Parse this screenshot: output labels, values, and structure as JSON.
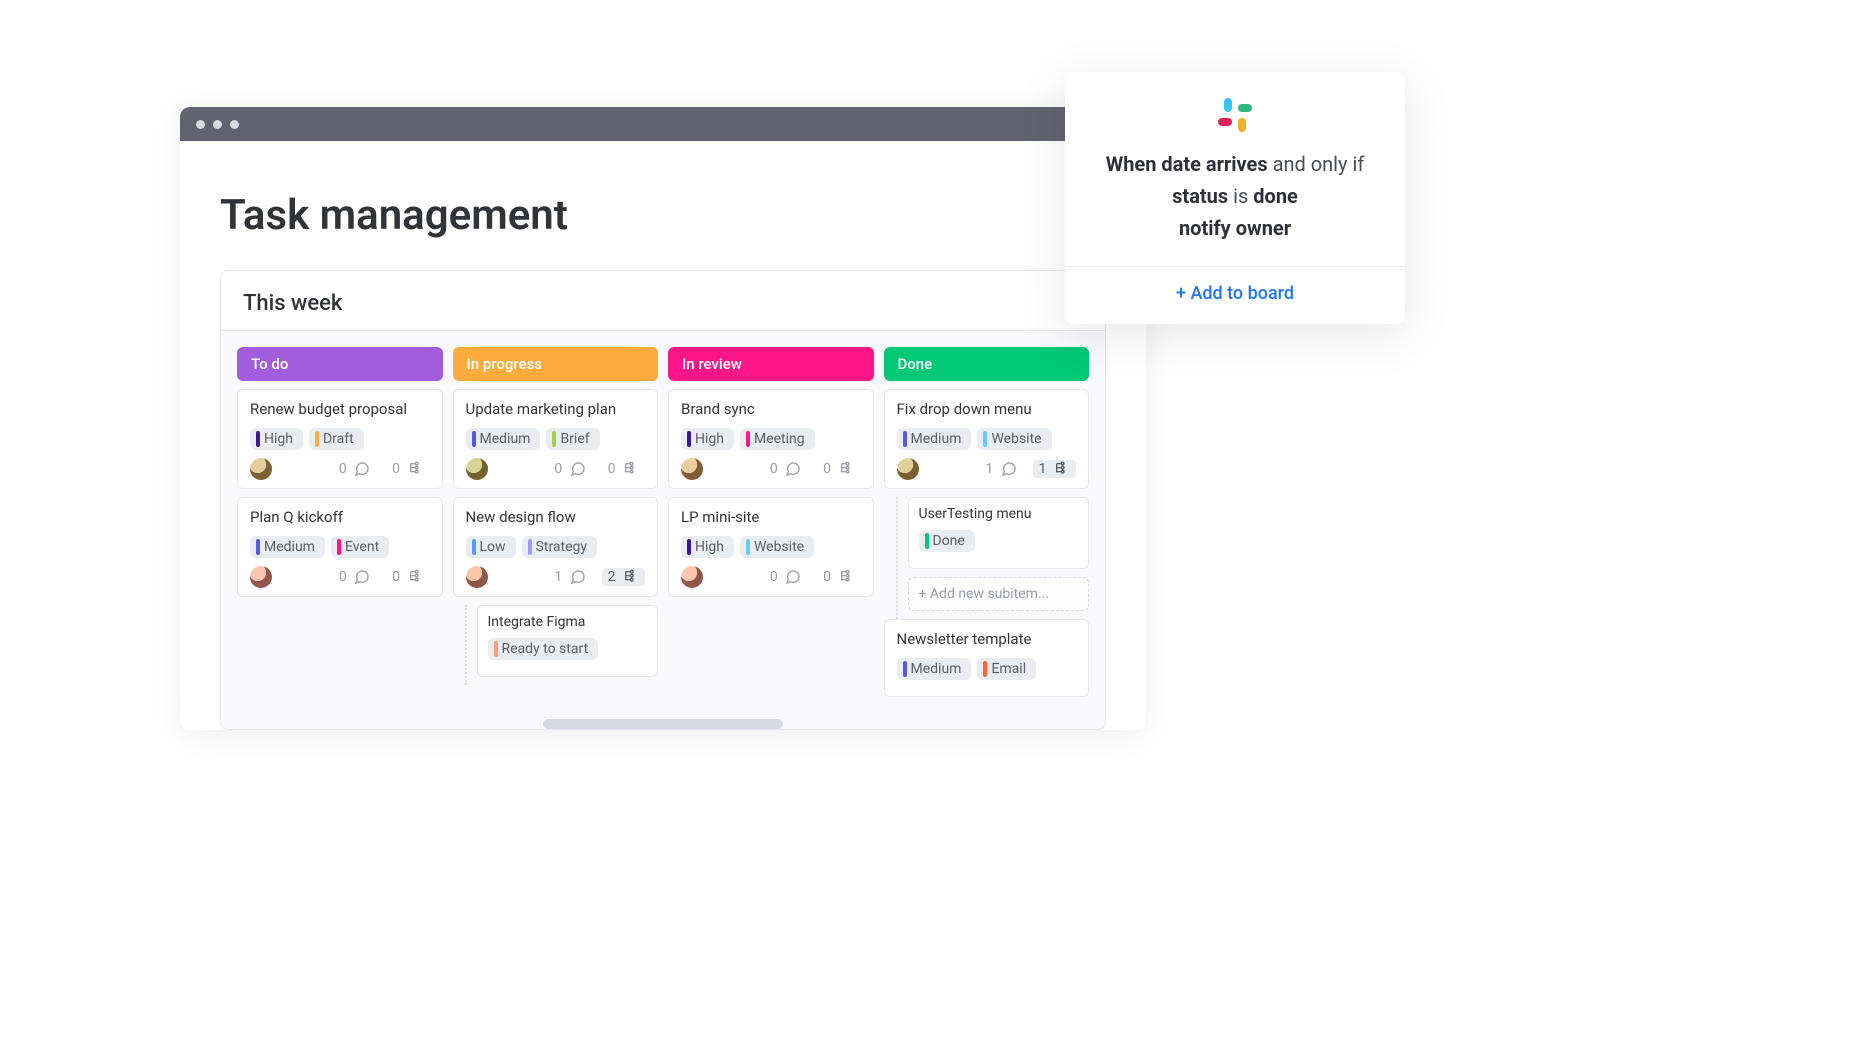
{
  "page": {
    "title": "Task management"
  },
  "group": {
    "title": "This  week"
  },
  "colors": {
    "todo": "#a25ddc",
    "in_progress": "#fdab3d",
    "in_review": "#ff158a",
    "done": "#00c875",
    "high": "#401694",
    "medium": "#5559df",
    "low": "#579bfc",
    "draft": "#fdab3d",
    "brief": "#a4d14b",
    "event": "#ff158a",
    "strategy": "#9d99ff",
    "meeting": "#ff158a",
    "website": "#66ccff",
    "ready": "#ff9d76",
    "done_tag": "#00c875",
    "email": "#ff642e"
  },
  "columns": [
    {
      "id": "todo",
      "title": "To do",
      "color_key": "todo",
      "cards": [
        {
          "title": "Renew budget proposal",
          "tags": [
            {
              "label": "High",
              "color_key": "high"
            },
            {
              "label": "Draft",
              "color_key": "draft"
            }
          ],
          "avatar_hue": 18,
          "comments": 0,
          "subtasks": 0,
          "hl_comments": false,
          "hl_subtasks": false
        },
        {
          "title": "Plan Q kickoff",
          "tags": [
            {
              "label": "Medium",
              "color_key": "medium"
            },
            {
              "label": "Event",
              "color_key": "event"
            }
          ],
          "avatar_hue": 340,
          "comments": 0,
          "subtasks": 0,
          "hl_comments": false,
          "hl_subtasks": false
        }
      ]
    },
    {
      "id": "in_progress",
      "title": "In progress",
      "color_key": "in_progress",
      "cards": [
        {
          "title": "Update marketing plan",
          "tags": [
            {
              "label": "Medium",
              "color_key": "medium"
            },
            {
              "label": "Brief",
              "color_key": "brief"
            }
          ],
          "avatar_hue": 30,
          "comments": 0,
          "subtasks": 0,
          "hl_comments": false,
          "hl_subtasks": false
        },
        {
          "title": "New design flow",
          "tags": [
            {
              "label": "Low",
              "color_key": "low"
            },
            {
              "label": "Strategy",
              "color_key": "strategy"
            }
          ],
          "avatar_hue": 350,
          "comments": 1,
          "subtasks": 2,
          "hl_comments": false,
          "hl_subtasks": true,
          "subitems": [
            {
              "title": "Integrate Figma",
              "tags": [
                {
                  "label": "Ready to start",
                  "color_key": "ready"
                }
              ]
            }
          ]
        }
      ]
    },
    {
      "id": "in_review",
      "title": "In review",
      "color_key": "in_review",
      "cards": [
        {
          "title": "Brand sync",
          "tags": [
            {
              "label": "High",
              "color_key": "high"
            },
            {
              "label": "Meeting",
              "color_key": "meeting"
            }
          ],
          "avatar_hue": 10,
          "comments": 0,
          "subtasks": 0,
          "hl_comments": false,
          "hl_subtasks": false
        },
        {
          "title": "LP mini-site",
          "tags": [
            {
              "label": "High",
              "color_key": "high"
            },
            {
              "label": "Website",
              "color_key": "website"
            }
          ],
          "avatar_hue": 345,
          "comments": 0,
          "subtasks": 0,
          "hl_comments": false,
          "hl_subtasks": false
        }
      ]
    },
    {
      "id": "done",
      "title": "Done",
      "color_key": "done",
      "cards": [
        {
          "title": "Fix drop down menu",
          "tags": [
            {
              "label": "Medium",
              "color_key": "medium"
            },
            {
              "label": "Website",
              "color_key": "website"
            }
          ],
          "avatar_hue": 20,
          "comments": 1,
          "subtasks": 1,
          "hl_comments": false,
          "hl_subtasks": true,
          "subitems": [
            {
              "title": "UserTesting menu",
              "tags": [
                {
                  "label": "Done",
                  "color_key": "done_tag"
                }
              ]
            }
          ],
          "add_sub_label": "+ Add new subitem..."
        },
        {
          "title": "Newsletter template",
          "tags": [
            {
              "label": "Medium",
              "color_key": "medium"
            },
            {
              "label": "Email",
              "color_key": "email"
            }
          ],
          "partial": true
        }
      ]
    }
  ],
  "automation": {
    "rule_parts": {
      "p1": "When date arrives",
      "p2": " and only if ",
      "p3": "status",
      "p4": " is ",
      "p5": "done",
      "p6": "notify owner"
    },
    "cta": "+ Add to board"
  }
}
